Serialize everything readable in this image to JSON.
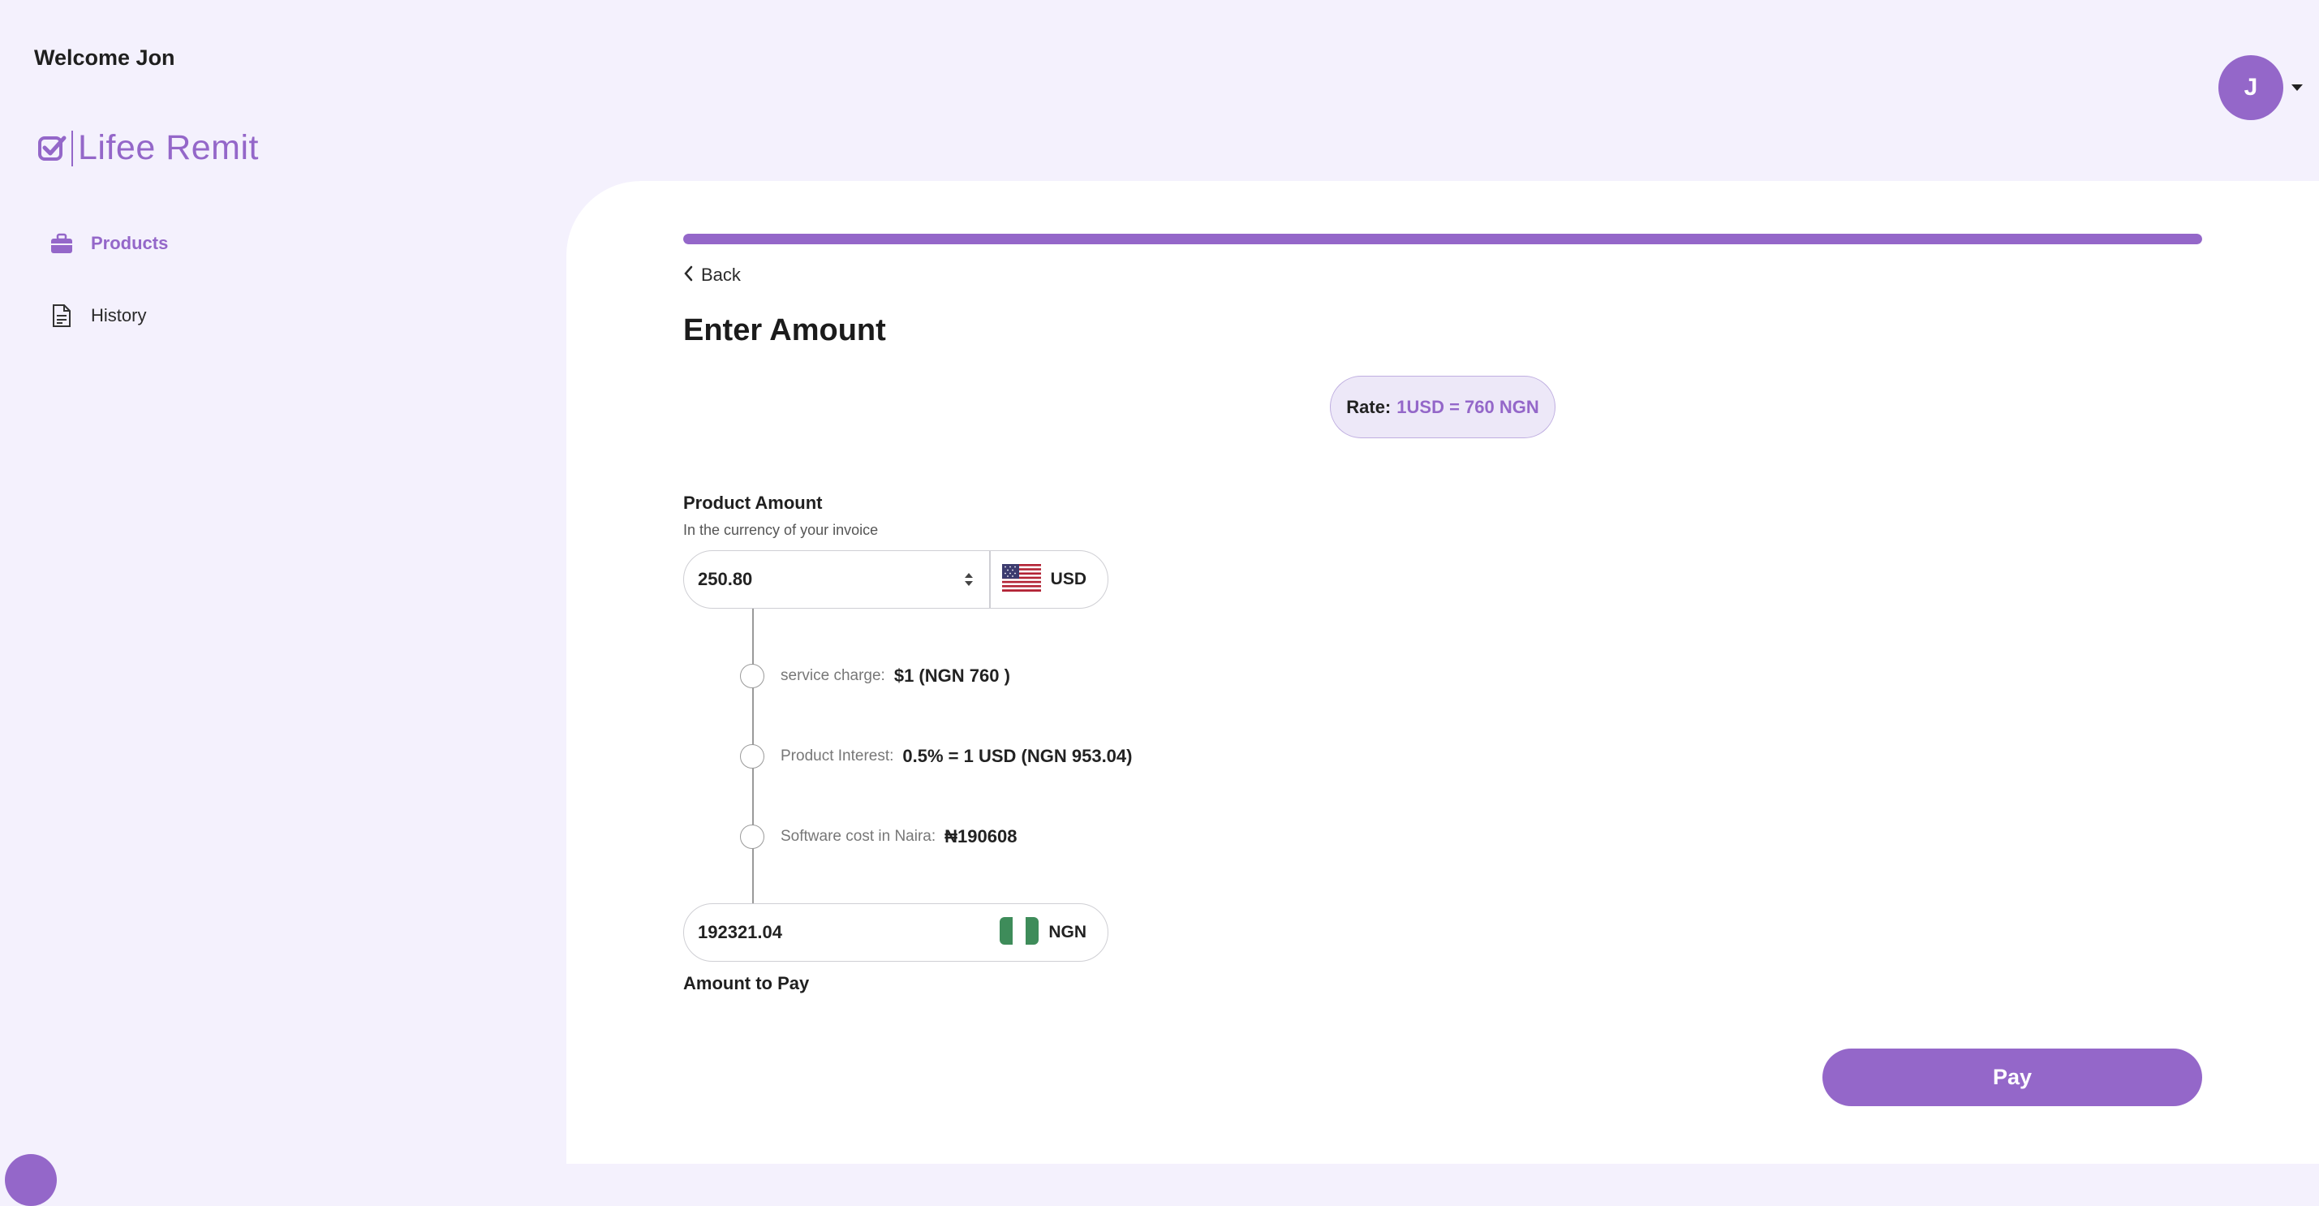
{
  "header": {
    "welcome": "Welcome Jon"
  },
  "brand": {
    "name": "Lifee Remit",
    "icon": "check-badge-icon",
    "color": "#9467c9"
  },
  "sidebar": {
    "items": [
      {
        "label": "Products",
        "icon": "briefcase-icon",
        "active": true
      },
      {
        "label": "History",
        "icon": "document-icon",
        "active": false
      }
    ]
  },
  "user": {
    "initial": "J"
  },
  "progress": {
    "percent": 100
  },
  "nav": {
    "back_label": "Back"
  },
  "page": {
    "title": "Enter Amount"
  },
  "rate": {
    "label": "Rate:",
    "value": "1USD = 760 NGN"
  },
  "product_amount": {
    "label": "Product Amount",
    "hint": "In the currency of your invoice",
    "value": "250.80",
    "currency": "USD",
    "flag": "us-flag-icon"
  },
  "breakdown": [
    {
      "label": "service charge:",
      "value": "$1 (NGN 760 )"
    },
    {
      "label": "Product Interest:",
      "value": "0.5% = 1 USD (NGN 953.04)"
    },
    {
      "label": "Software cost in Naira:",
      "value": "₦190608"
    }
  ],
  "amount_to_pay": {
    "value": "192321.04",
    "currency": "NGN",
    "flag": "ng-flag-icon",
    "label": "Amount to Pay"
  },
  "actions": {
    "pay_label": "Pay"
  }
}
